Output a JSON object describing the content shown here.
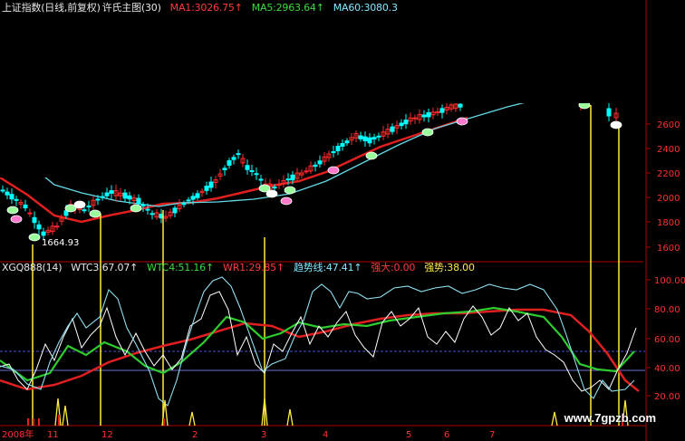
{
  "main_header": {
    "name": "上证指数(日线,前复权)",
    "indicator": "许氏主图(30)",
    "ma1": "MA1:3026.75↑",
    "ma5": "MA5:2963.64↑",
    "ma60": "MA60:3080.3"
  },
  "indicator_header": {
    "name": "XGQ888(14)",
    "wtc3": "WTC3:67.07↑",
    "wtc4": "WTC4:51.16↑",
    "wr1": "WR1:29.85↑",
    "trend": "趋势线:47.41↑",
    "strong_big": "强大:0.00",
    "strong": "强势:38.00"
  },
  "low_label": "1664.93",
  "watermark": "www.7gpzb.com",
  "price_axis": [
    "2600",
    "2400",
    "2200",
    "2000",
    "1800",
    "1600"
  ],
  "indicator_axis": [
    "100.00",
    "80.00",
    "60.00",
    "40.00",
    "20.00"
  ],
  "date_axis": [
    "2008年",
    "11",
    "12",
    "2",
    "3",
    "4",
    "5",
    "6",
    "7"
  ],
  "colors": {
    "up_candle": "#ff2a2a",
    "down_candle": "#00ffff",
    "ma_red": "#e0201e",
    "ma_cyan": "#66d8e6",
    "wtc3_white": "#ffffff",
    "wtc4_green": "#2ecc2e",
    "wr1_red": "#e02020",
    "trend_cyan": "#8fe0f0",
    "signal_yellow": "#ffec3a"
  }
}
